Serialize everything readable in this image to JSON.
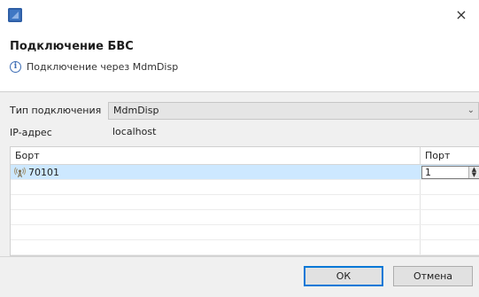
{
  "window": {
    "close_glyph": "×"
  },
  "header": {
    "title": "Подключение БВС",
    "info_text": "Подключение через MdmDisp"
  },
  "form": {
    "connection_type_label": "Тип подключения",
    "connection_type_value": "MdmDisp",
    "ip_label": "IP-адрес",
    "ip_value": "localhost"
  },
  "table": {
    "columns": [
      "Борт",
      "Порт"
    ],
    "rows": [
      {
        "board": "70101",
        "port": "1",
        "selected": true
      }
    ]
  },
  "buttons": {
    "ok_label": "ОК",
    "cancel_label": "Отмена"
  },
  "colors": {
    "selection": "#cde8ff",
    "default_button_border": "#0078d7",
    "body_background": "#f0f0f0"
  },
  "icons": {
    "app": "app-icon",
    "info": "info-icon",
    "board": "antenna-icon",
    "close": "close-icon"
  }
}
